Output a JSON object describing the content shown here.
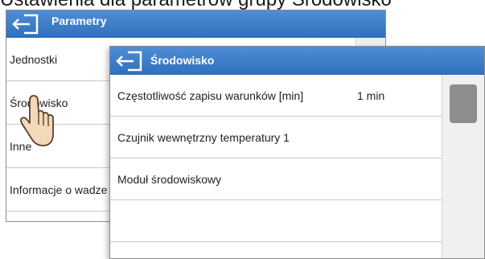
{
  "caption": "Ustawienia dla parametrów grupy Środowisko",
  "back_window": {
    "title": "Parametry",
    "items": [
      {
        "label": "Jednostki"
      },
      {
        "label": "Środowisko"
      },
      {
        "label": "Inne"
      },
      {
        "label": "Informacje o wadze"
      }
    ]
  },
  "front_window": {
    "title": "Środowisko",
    "rows": [
      {
        "label": "Częstotliwość zapisu warunków [min]",
        "value": "1 min"
      },
      {
        "label": "Czujnik wewnętrzny temperatury 1",
        "value": ""
      },
      {
        "label": "Moduł środowiskowy",
        "value": ""
      },
      {
        "label": "",
        "value": ""
      }
    ]
  },
  "icons": {
    "back": "back-arrow-icon",
    "pointer": "hand-pointer-icon"
  },
  "colors": {
    "titlebar": "#3a7cc9",
    "scroll_thumb": "#8e8e8e",
    "divider": "#c9c9c9"
  }
}
